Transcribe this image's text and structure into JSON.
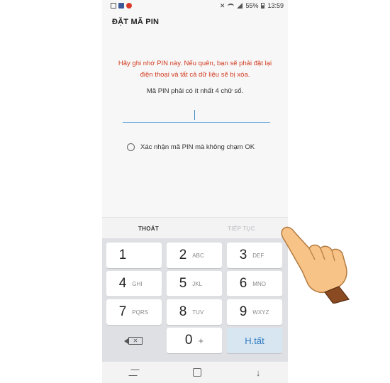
{
  "status_bar": {
    "battery": "55%",
    "time": "13:59"
  },
  "screen": {
    "title": "ĐẶT MÃ PIN",
    "warning": "Hãy ghi nhớ PIN này. Nếu quên, bạn sẽ phải đặt lại điện thoại và tất cả dữ liệu sẽ bị xóa.",
    "hint": "Mã PIN phải có ít nhất 4 chữ số.",
    "pin_value": "",
    "confirm_label": "Xác nhận mã PIN mà không chạm OK"
  },
  "actions": {
    "exit_label": "THOÁT",
    "next_label": "TIẾP TỤC"
  },
  "keypad": {
    "keys": [
      {
        "num": "1",
        "letters": ""
      },
      {
        "num": "2",
        "letters": "ABC"
      },
      {
        "num": "3",
        "letters": "DEF"
      },
      {
        "num": "4",
        "letters": "GHI"
      },
      {
        "num": "5",
        "letters": "JKL"
      },
      {
        "num": "6",
        "letters": "MNO"
      },
      {
        "num": "7",
        "letters": "PQRS"
      },
      {
        "num": "8",
        "letters": "TUV"
      },
      {
        "num": "9",
        "letters": "WXYZ"
      }
    ],
    "zero": "0",
    "plus": "+",
    "done_label": "H.tất"
  },
  "colors": {
    "warning": "#d23b1e",
    "accent": "#2f7cc0",
    "keypad_bg": "#dfe0e4"
  }
}
